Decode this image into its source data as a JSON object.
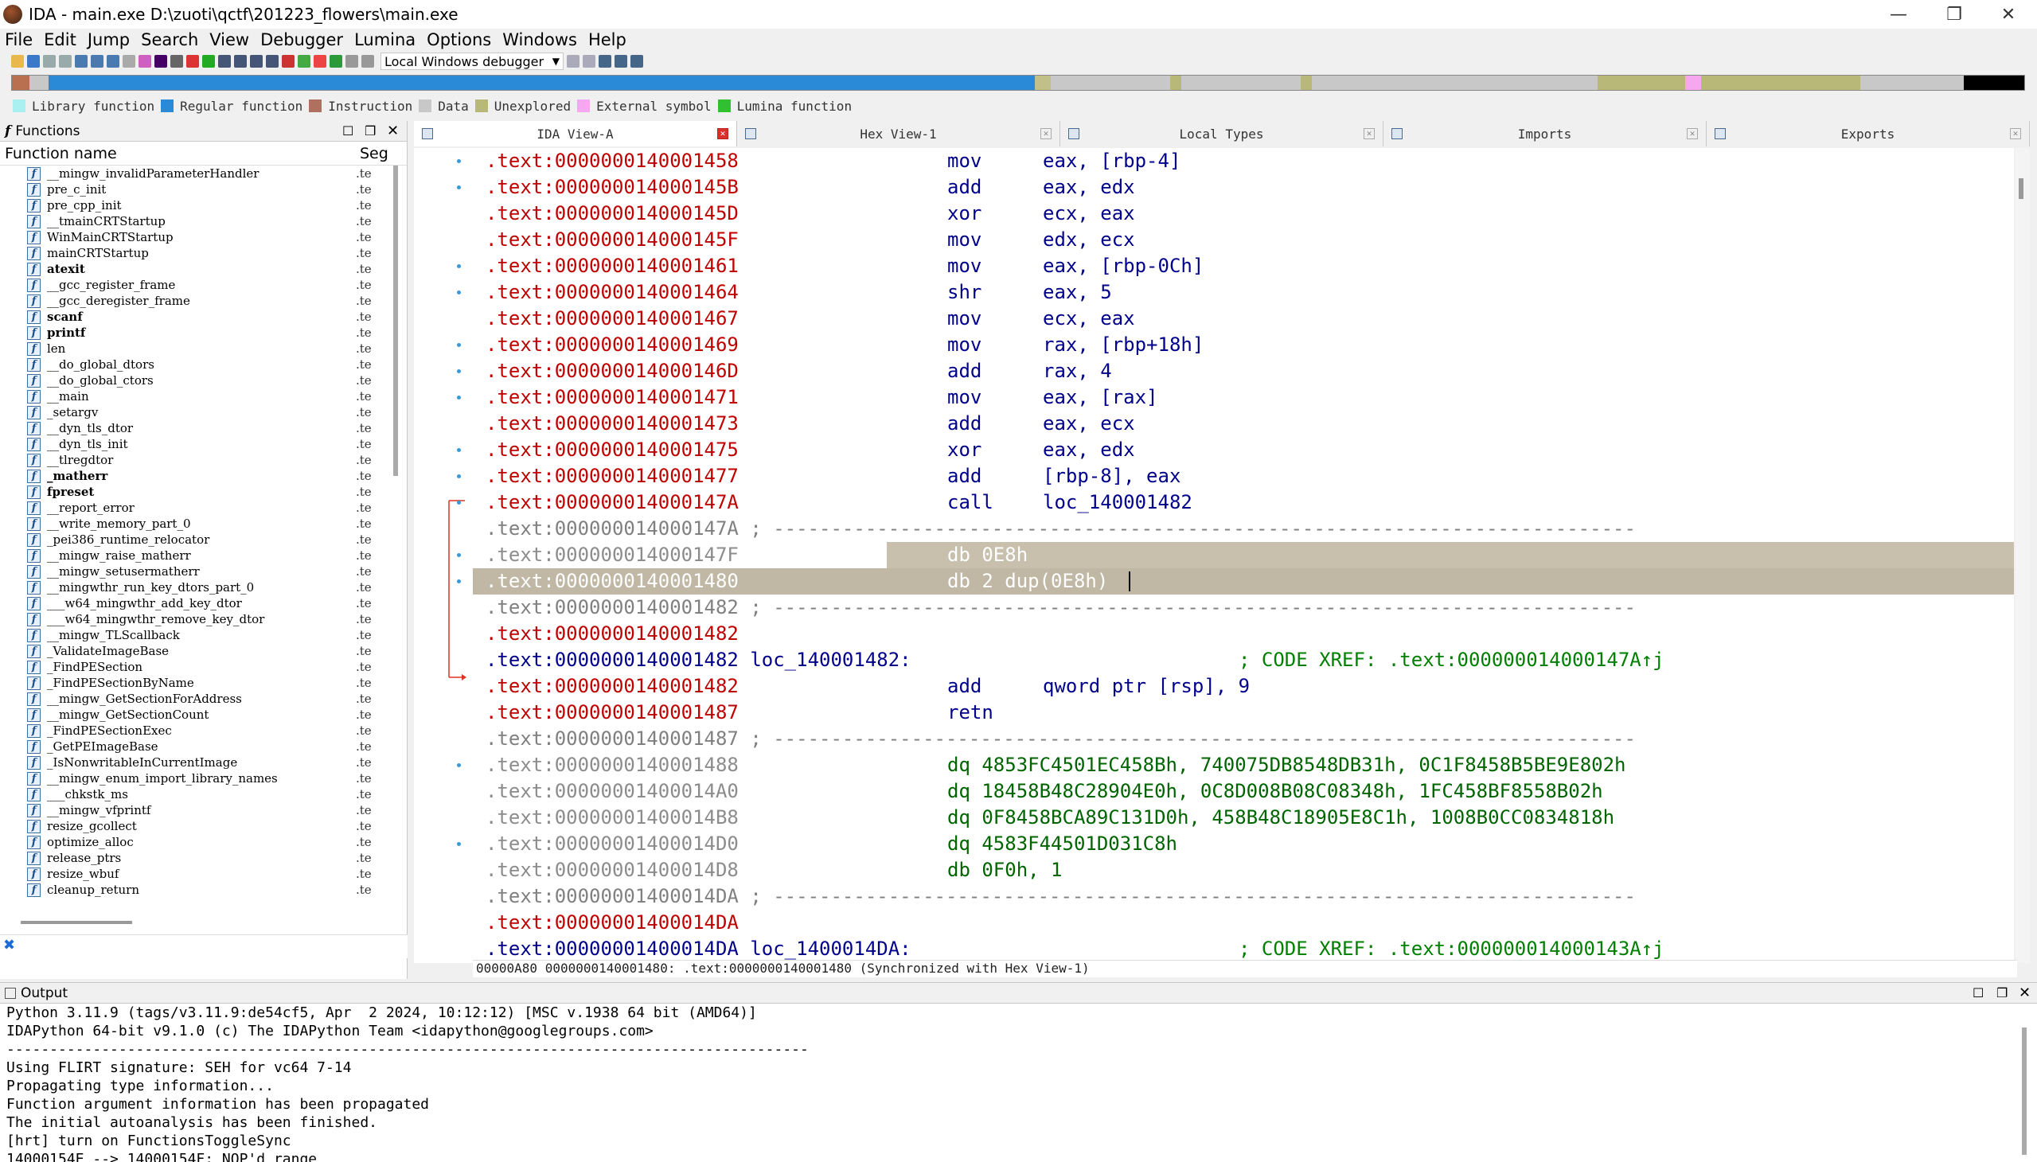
{
  "window": {
    "title": "IDA - main.exe D:\\zuoti\\qctf\\201223_flowers\\main.exe",
    "minimize_label": "—",
    "maximize_label": "❐",
    "close_label": "✕"
  },
  "menu": [
    "File",
    "Edit",
    "Jump",
    "Search",
    "View",
    "Debugger",
    "Lumina",
    "Options",
    "Windows",
    "Help"
  ],
  "toolbar": {
    "debugger": "Local Windows debugger"
  },
  "legend": [
    {
      "label": "Library function",
      "color": "#aaf0f0"
    },
    {
      "label": "Regular function",
      "color": "#2a8ad8"
    },
    {
      "label": "Instruction",
      "color": "#b07060"
    },
    {
      "label": "Data",
      "color": "#c8c8c8"
    },
    {
      "label": "Unexplored",
      "color": "#b8b878"
    },
    {
      "label": "External symbol",
      "color": "#f5a8f0"
    },
    {
      "label": "Lumina function",
      "color": "#30c030"
    }
  ],
  "functions": {
    "title": "Functions",
    "col_name": "Function name",
    "col_seg": "Seg",
    "items": [
      {
        "name": "__mingw_invalidParameterHandler",
        "seg": ".te",
        "bold": false
      },
      {
        "name": "pre_c_init",
        "seg": ".te",
        "bold": false
      },
      {
        "name": "pre_cpp_init",
        "seg": ".te",
        "bold": false
      },
      {
        "name": "__tmainCRTStartup",
        "seg": ".te",
        "bold": false
      },
      {
        "name": "WinMainCRTStartup",
        "seg": ".te",
        "bold": false
      },
      {
        "name": "mainCRTStartup",
        "seg": ".te",
        "bold": false
      },
      {
        "name": "atexit",
        "seg": ".te",
        "bold": true
      },
      {
        "name": "__gcc_register_frame",
        "seg": ".te",
        "bold": false
      },
      {
        "name": "__gcc_deregister_frame",
        "seg": ".te",
        "bold": false
      },
      {
        "name": "scanf",
        "seg": ".te",
        "bold": true
      },
      {
        "name": "printf",
        "seg": ".te",
        "bold": true
      },
      {
        "name": "len",
        "seg": ".te",
        "bold": false
      },
      {
        "name": "__do_global_dtors",
        "seg": ".te",
        "bold": false
      },
      {
        "name": "__do_global_ctors",
        "seg": ".te",
        "bold": false
      },
      {
        "name": "__main",
        "seg": ".te",
        "bold": false
      },
      {
        "name": "_setargv",
        "seg": ".te",
        "bold": false
      },
      {
        "name": "__dyn_tls_dtor",
        "seg": ".te",
        "bold": false
      },
      {
        "name": "__dyn_tls_init",
        "seg": ".te",
        "bold": false
      },
      {
        "name": "__tlregdtor",
        "seg": ".te",
        "bold": false
      },
      {
        "name": "_matherr",
        "seg": ".te",
        "bold": true
      },
      {
        "name": "fpreset",
        "seg": ".te",
        "bold": true
      },
      {
        "name": "__report_error",
        "seg": ".te",
        "bold": false
      },
      {
        "name": "__write_memory_part_0",
        "seg": ".te",
        "bold": false
      },
      {
        "name": "_pei386_runtime_relocator",
        "seg": ".te",
        "bold": false
      },
      {
        "name": "__mingw_raise_matherr",
        "seg": ".te",
        "bold": false
      },
      {
        "name": "__mingw_setusermatherr",
        "seg": ".te",
        "bold": false
      },
      {
        "name": "__mingwthr_run_key_dtors_part_0",
        "seg": ".te",
        "bold": false
      },
      {
        "name": "___w64_mingwthr_add_key_dtor",
        "seg": ".te",
        "bold": false
      },
      {
        "name": "___w64_mingwthr_remove_key_dtor",
        "seg": ".te",
        "bold": false
      },
      {
        "name": "__mingw_TLScallback",
        "seg": ".te",
        "bold": false
      },
      {
        "name": "_ValidateImageBase",
        "seg": ".te",
        "bold": false
      },
      {
        "name": "_FindPESection",
        "seg": ".te",
        "bold": false
      },
      {
        "name": "_FindPESectionByName",
        "seg": ".te",
        "bold": false
      },
      {
        "name": "__mingw_GetSectionForAddress",
        "seg": ".te",
        "bold": false
      },
      {
        "name": "__mingw_GetSectionCount",
        "seg": ".te",
        "bold": false
      },
      {
        "name": "_FindPESectionExec",
        "seg": ".te",
        "bold": false
      },
      {
        "name": "_GetPEImageBase",
        "seg": ".te",
        "bold": false
      },
      {
        "name": "_IsNonwritableInCurrentImage",
        "seg": ".te",
        "bold": false
      },
      {
        "name": "__mingw_enum_import_library_names",
        "seg": ".te",
        "bold": false
      },
      {
        "name": "___chkstk_ms",
        "seg": ".te",
        "bold": false
      },
      {
        "name": "__mingw_vfprintf",
        "seg": ".te",
        "bold": false
      },
      {
        "name": "resize_gcollect",
        "seg": ".te",
        "bold": false
      },
      {
        "name": "optimize_alloc",
        "seg": ".te",
        "bold": false
      },
      {
        "name": "release_ptrs",
        "seg": ".te",
        "bold": false
      },
      {
        "name": "resize_wbuf",
        "seg": ".te",
        "bold": false
      },
      {
        "name": "cleanup_return",
        "seg": ".te",
        "bold": false
      }
    ]
  },
  "tabs": [
    {
      "label": "IDA View-A",
      "active": true
    },
    {
      "label": "Hex View-1",
      "active": false
    },
    {
      "label": "Local Types",
      "active": false
    },
    {
      "label": "Imports",
      "active": false
    },
    {
      "label": "Exports",
      "active": false
    }
  ],
  "disasm": [
    {
      "addr": ".text:0000000140001458",
      "mn": "mov",
      "op": "eax, [rbp-4]"
    },
    {
      "addr": ".text:000000014000145B",
      "mn": "add",
      "op": "eax, edx"
    },
    {
      "addr": ".text:000000014000145D",
      "mn": "xor",
      "op": "ecx, eax"
    },
    {
      "addr": ".text:000000014000145F",
      "mn": "mov",
      "op": "edx, ecx"
    },
    {
      "addr": ".text:0000000140001461",
      "mn": "mov",
      "op": "eax, [rbp-0Ch]"
    },
    {
      "addr": ".text:0000000140001464",
      "mn": "shr",
      "op": "eax, 5"
    },
    {
      "addr": ".text:0000000140001467",
      "mn": "mov",
      "op": "ecx, eax"
    },
    {
      "addr": ".text:0000000140001469",
      "mn": "mov",
      "op": "rax, [rbp+18h]"
    },
    {
      "addr": ".text:000000014000146D",
      "mn": "add",
      "op": "rax, 4"
    },
    {
      "addr": ".text:0000000140001471",
      "mn": "mov",
      "op": "eax, [rax]"
    },
    {
      "addr": ".text:0000000140001473",
      "mn": "add",
      "op": "eax, ecx"
    },
    {
      "addr": ".text:0000000140001475",
      "mn": "xor",
      "op": "eax, edx"
    },
    {
      "addr": ".text:0000000140001477",
      "mn": "add",
      "op": "[rbp-8], eax"
    },
    {
      "addr": ".text:000000014000147A",
      "mn": "call",
      "op": "loc_140001482"
    }
  ],
  "disasm2": {
    "sep1": ".text:000000014000147A ; ---------------------------------------------------------------------------",
    "db1_addr": ".text:000000014000147F",
    "db1": "db 0E8h",
    "db2_addr": ".text:0000000140001480",
    "db2": "db 2 dup(0E8h)",
    "sep2": ".text:0000000140001482 ; ---------------------------------------------------------------------------",
    "blank1": ".text:0000000140001482",
    "loc1": ".text:0000000140001482 loc_140001482:",
    "loc1_cmt": "; CODE XREF: .text:000000014000147A↑j",
    "l_add_addr": ".text:0000000140001482",
    "l_add_mn": "add",
    "l_add_op": "qword ptr [rsp], 9",
    "l_retn_addr": ".text:0000000140001487",
    "l_retn_mn": "retn",
    "sep3": ".text:0000000140001487 ; ---------------------------------------------------------------------------",
    "dq": [
      {
        "addr": ".text:0000000140001488",
        "val": "dq 4853FC4501EC458Bh, 740075DB8548DB31h, 0C1F8458B5BE9E802h"
      },
      {
        "addr": ".text:00000001400014A0",
        "val": "dq 18458B48C28904E0h, 0C8D008B08C08348h, 1FC458BF8558B02h"
      },
      {
        "addr": ".text:00000001400014B8",
        "val": "dq 0F8458BCA89C131D0h, 458B48C18905E8C1h, 1008B0CC0834818h"
      },
      {
        "addr": ".text:00000001400014D0",
        "val": "dq 4583F44501D031C8h"
      },
      {
        "addr": ".text:00000001400014D8",
        "val": "db 0F0h, 1"
      }
    ],
    "sep4": ".text:00000001400014DA ; ---------------------------------------------------------------------------",
    "blank2": ".text:00000001400014DA",
    "loc2": ".text:00000001400014DA loc_1400014DA:",
    "loc2_cmt": "; CODE XREF: .text:000000014000143A↑j"
  },
  "status": "00000A80 0000000140001480: .text:0000000140001480 (Synchronized with Hex View-1)",
  "output": {
    "title": "Output",
    "lines": [
      "Python 3.11.9 (tags/v3.11.9:de54cf5, Apr  2 2024, 10:12:12) [MSC v.1938 64 bit (AMD64)]",
      "IDAPython 64-bit v9.1.0 (c) The IDAPython Team <idapython@googlegroups.com>",
      "---------------------------------------------------------------------------------------------",
      "Using FLIRT signature: SEH for vc64 7-14",
      "Propagating type information...",
      "Function argument information has been propagated",
      "The initial autoanalysis has been finished.",
      "[hrt] turn on FunctionsToggleSync",
      "14000154E --> 14000154F: NOP'd range"
    ]
  }
}
